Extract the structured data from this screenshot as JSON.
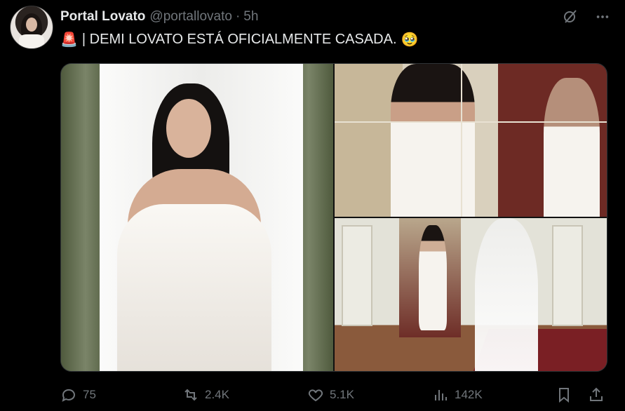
{
  "author": {
    "name": "Portal Lovato",
    "handle": "@portallovato",
    "separator": "·",
    "time": "5h"
  },
  "post": {
    "siren_emoji": "🚨",
    "text": "| DEMI LOVATO ESTÁ OFICIALMENTE CASADA.",
    "trailing_emoji": "🥹"
  },
  "media": {
    "images": [
      "bride-portrait-photo",
      "bride-mirror-photo",
      "bride-room-photo"
    ]
  },
  "actions": {
    "replies": "75",
    "reposts": "2.4K",
    "likes": "5.1K",
    "views": "142K"
  },
  "icons": {
    "grok": "grok-icon",
    "more": "more-icon",
    "reply": "reply-icon",
    "repost": "repost-icon",
    "like": "heart-icon",
    "views": "views-icon",
    "bookmark": "bookmark-icon",
    "share": "share-icon"
  },
  "colors": {
    "background": "#000000",
    "text": "#e7e9ea",
    "muted": "#71767b"
  }
}
